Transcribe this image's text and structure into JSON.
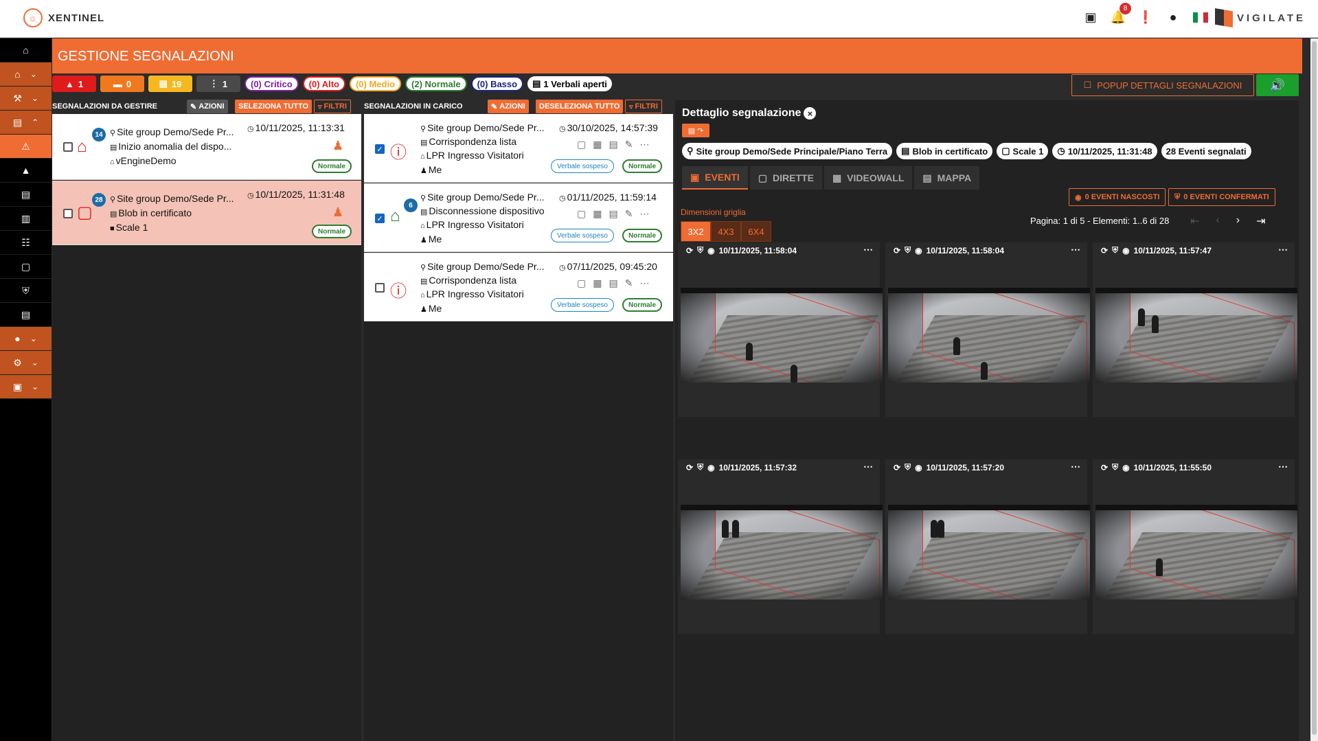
{
  "app": {
    "name": "XENTINEL",
    "brand": "VIGILATE",
    "notifications": "8"
  },
  "page": {
    "title": "GESTIONE SEGNALAZIONI"
  },
  "stats": {
    "critico_count": "1",
    "alto_count": "0",
    "medio_count": "19",
    "basso_count": "1"
  },
  "filters": {
    "critico": "(0) Critico",
    "alto": "(0) Alto",
    "medio": "(0) Medio",
    "normale": "(2) Normale",
    "basso": "(0) Basso",
    "verbali": "1 Verbali aperti"
  },
  "popup_label": "POPUP DETTAGLI SEGNALAZIONI",
  "left_col": {
    "title": "SEGNALAZIONI DA GESTIRE",
    "azioni": "AZIONI",
    "seleziona": "SELEZIONA TUTTO",
    "filtri": "FILTRI",
    "cards": [
      {
        "badge": "14",
        "site": "Site group Demo/Sede Pr...",
        "time": "10/11/2025, 11:13:31",
        "line2": "Inizio anomalia del dispo...",
        "line3": "vEngineDemo",
        "prio": "Normale"
      },
      {
        "badge": "28",
        "site": "Site group Demo/Sede Pr...",
        "time": "10/11/2025, 11:31:48",
        "line2": "Blob in certificato",
        "line3": "Scale 1",
        "prio": "Normale"
      }
    ]
  },
  "mid_col": {
    "title": "SEGNALAZIONI IN CARICO",
    "azioni": "AZIONI",
    "deseleziona": "DESELEZIONA TUTTO",
    "filtri": "FILTRI",
    "cards": [
      {
        "site": "Site group Demo/Sede Pr...",
        "time": "30/10/2025, 14:57:39",
        "line2": "Corrispondenza lista",
        "line3": "LPR Ingresso Visitatori",
        "line4": "Me",
        "verbale": "Verbale sospeso",
        "prio": "Normale"
      },
      {
        "badge": "6",
        "site": "Site group Demo/Sede Pr...",
        "time": "01/11/2025, 11:59:14",
        "line2": "Disconnessione dispositivo",
        "line3": "LPR Ingresso Visitatori",
        "line4": "Me",
        "verbale": "Verbale sospeso",
        "prio": "Normale"
      },
      {
        "site": "Site group Demo/Sede Pr...",
        "time": "07/11/2025, 09:45:20",
        "line2": "Corrispondenza lista",
        "line3": "LPR Ingresso Visitatori",
        "line4": "Me",
        "verbale": "Verbale sospeso",
        "prio": "Normale"
      }
    ]
  },
  "detail": {
    "title": "Dettaglio segnalazione",
    "chips": {
      "site": "Site group Demo/Sede Principale/Piano Terra",
      "type": "Blob in certificato",
      "camera": "Scale 1",
      "time": "10/11/2025, 11:31:48",
      "events": "28 Eventi segnalati"
    },
    "tabs": {
      "eventi": "EVENTI",
      "dirette": "DIRETTE",
      "videowall": "VIDEOWALL",
      "mappa": "MAPPA"
    },
    "nascosti": "0 EVENTI NASCOSTI",
    "confermati": "0 EVENTI CONFERMATI",
    "grid_label": "Dimensioni griglia",
    "grid_opts": [
      "3X2",
      "4X3",
      "6X4"
    ],
    "page_info": "Pagina: 1 di 5 - Elementi: 1..6 di 28",
    "events": [
      {
        "time": "10/11/2025, 11:58:04"
      },
      {
        "time": "10/11/2025, 11:58:04"
      },
      {
        "time": "10/11/2025, 11:57:47"
      },
      {
        "time": "10/11/2025, 11:57:32"
      },
      {
        "time": "10/11/2025, 11:57:20"
      },
      {
        "time": "10/11/2025, 11:55:50"
      }
    ]
  },
  "colors": {
    "accent": "#ef6c33",
    "critico": "#e01b1b",
    "alto": "#f0791f",
    "medio": "#f5a623",
    "normale": "#2e7d32",
    "basso": "#1a237e"
  }
}
